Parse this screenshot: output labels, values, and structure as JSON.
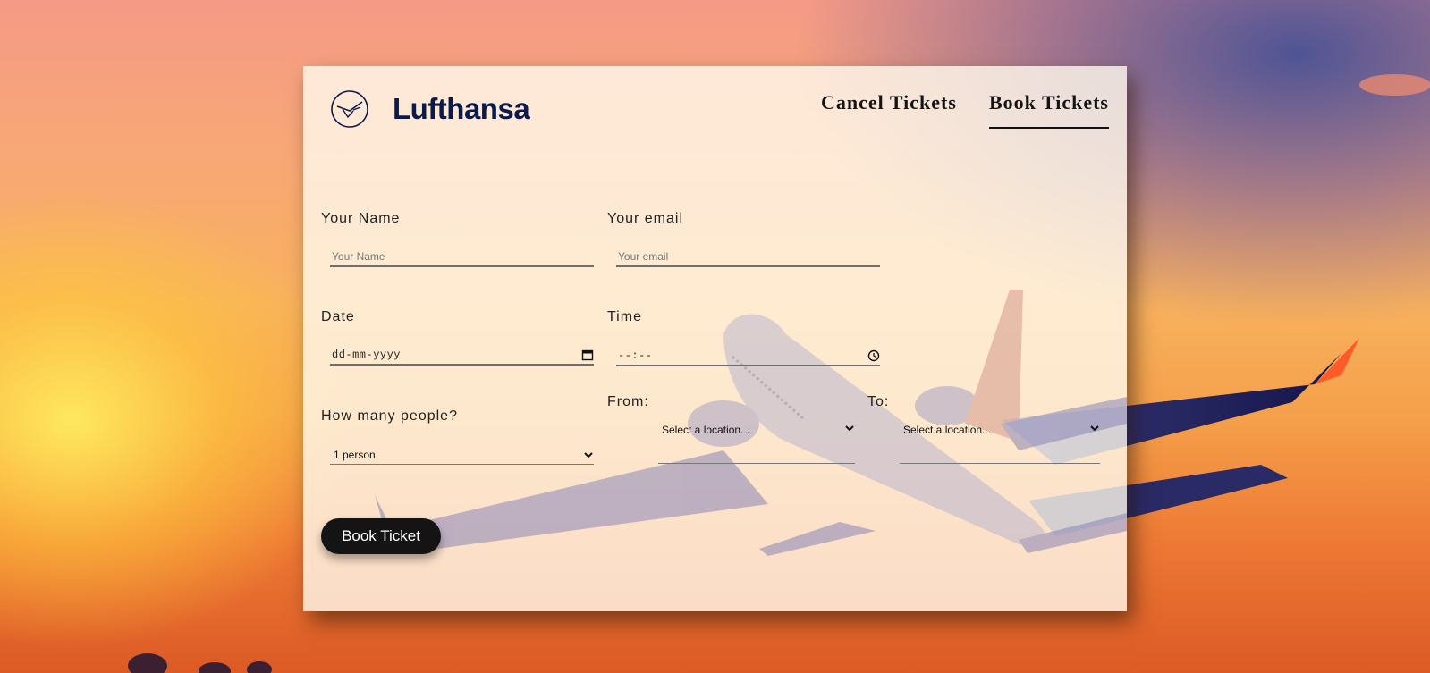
{
  "brand": {
    "name": "Lufthansa",
    "color": "#0b1a4a"
  },
  "nav": {
    "cancel": "Cancel Tickets",
    "book": "Book Tickets",
    "active": "book"
  },
  "form": {
    "name": {
      "label": "Your Name",
      "placeholder": "Your Name"
    },
    "email": {
      "label": "Your email",
      "placeholder": "Your email"
    },
    "date": {
      "label": "Date",
      "value": "dd-mm-yyyy"
    },
    "time": {
      "label": "Time",
      "value": "--:--"
    },
    "people": {
      "label": "How many people?",
      "value": "1 person"
    },
    "from": {
      "label": "From:",
      "value": "Select a location..."
    },
    "to": {
      "label": "To:",
      "value": "Select a location..."
    },
    "submit": "Book Ticket"
  },
  "icons": [
    "lufthansa-crane-icon",
    "calendar-icon",
    "clock-icon",
    "chevron-down-icon"
  ]
}
